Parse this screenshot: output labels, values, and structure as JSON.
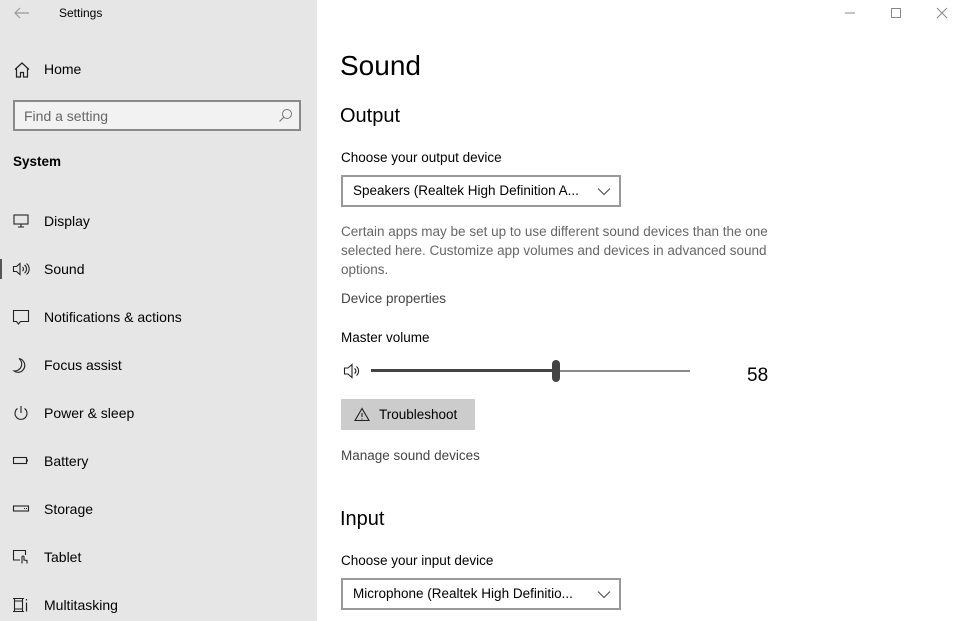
{
  "window": {
    "title": "Settings",
    "back_icon": "back-arrow-icon",
    "controls": {
      "minimize_icon": "minimize-icon",
      "maximize_icon": "maximize-icon",
      "close_icon": "close-icon"
    }
  },
  "sidebar": {
    "home": {
      "label": "Home",
      "icon": "home-icon"
    },
    "search": {
      "placeholder": "Find a setting",
      "value": "",
      "icon": "search-icon"
    },
    "section_label": "System",
    "selected": "Sound",
    "items": [
      {
        "label": "Display",
        "icon": "display-icon"
      },
      {
        "label": "Sound",
        "icon": "speaker-icon"
      },
      {
        "label": "Notifications & actions",
        "icon": "notifications-icon"
      },
      {
        "label": "Focus assist",
        "icon": "moon-icon"
      },
      {
        "label": "Power & sleep",
        "icon": "power-icon"
      },
      {
        "label": "Battery",
        "icon": "battery-icon"
      },
      {
        "label": "Storage",
        "icon": "storage-icon"
      },
      {
        "label": "Tablet",
        "icon": "tablet-icon"
      },
      {
        "label": "Multitasking",
        "icon": "multitasking-icon"
      }
    ]
  },
  "main": {
    "title": "Sound",
    "output": {
      "heading": "Output",
      "device_label": "Choose your output device",
      "device_value": "Speakers (Realtek High Definition A...",
      "description": "Certain apps may be set up to use different sound devices than the one selected here. Customize app volumes and devices in advanced sound options.",
      "device_properties_link": "Device properties",
      "master_volume_label": "Master volume",
      "volume_percent": 58,
      "volume_display": "58",
      "troubleshoot_label": "Troubleshoot",
      "troubleshoot_icon": "warning-icon",
      "manage_devices_link": "Manage sound devices"
    },
    "input": {
      "heading": "Input",
      "device_label": "Choose your input device",
      "device_value": "Microphone (Realtek High Definitio..."
    }
  }
}
